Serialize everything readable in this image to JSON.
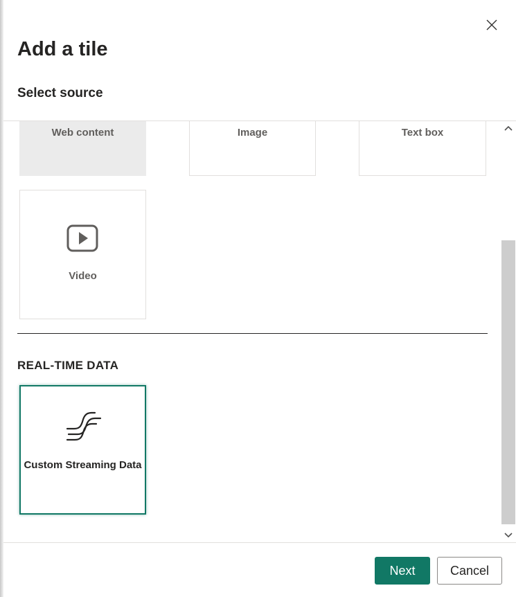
{
  "dialog": {
    "title": "Add a tile",
    "subtitle": "Select source",
    "close_icon": "close-icon"
  },
  "tiles": [
    {
      "label": "Web content",
      "state": "hover"
    },
    {
      "label": "Image"
    },
    {
      "label": "Text box"
    },
    {
      "label": "Video",
      "icon": "video-play-icon"
    }
  ],
  "realtime": {
    "heading": "REAL-TIME DATA",
    "tiles": [
      {
        "label": "Custom Streaming Data",
        "icon": "streaming-data-icon",
        "selected": true
      }
    ]
  },
  "scrollbar": {
    "up_icon": "chevron-up-icon",
    "down_icon": "chevron-down-icon"
  },
  "footer": {
    "next_label": "Next",
    "cancel_label": "Cancel"
  },
  "colors": {
    "accent": "#117865",
    "tile_hover_bg": "#ebebeb",
    "text_primary": "#252423",
    "text_secondary": "#605e5c",
    "border": "#e1dfdd"
  }
}
